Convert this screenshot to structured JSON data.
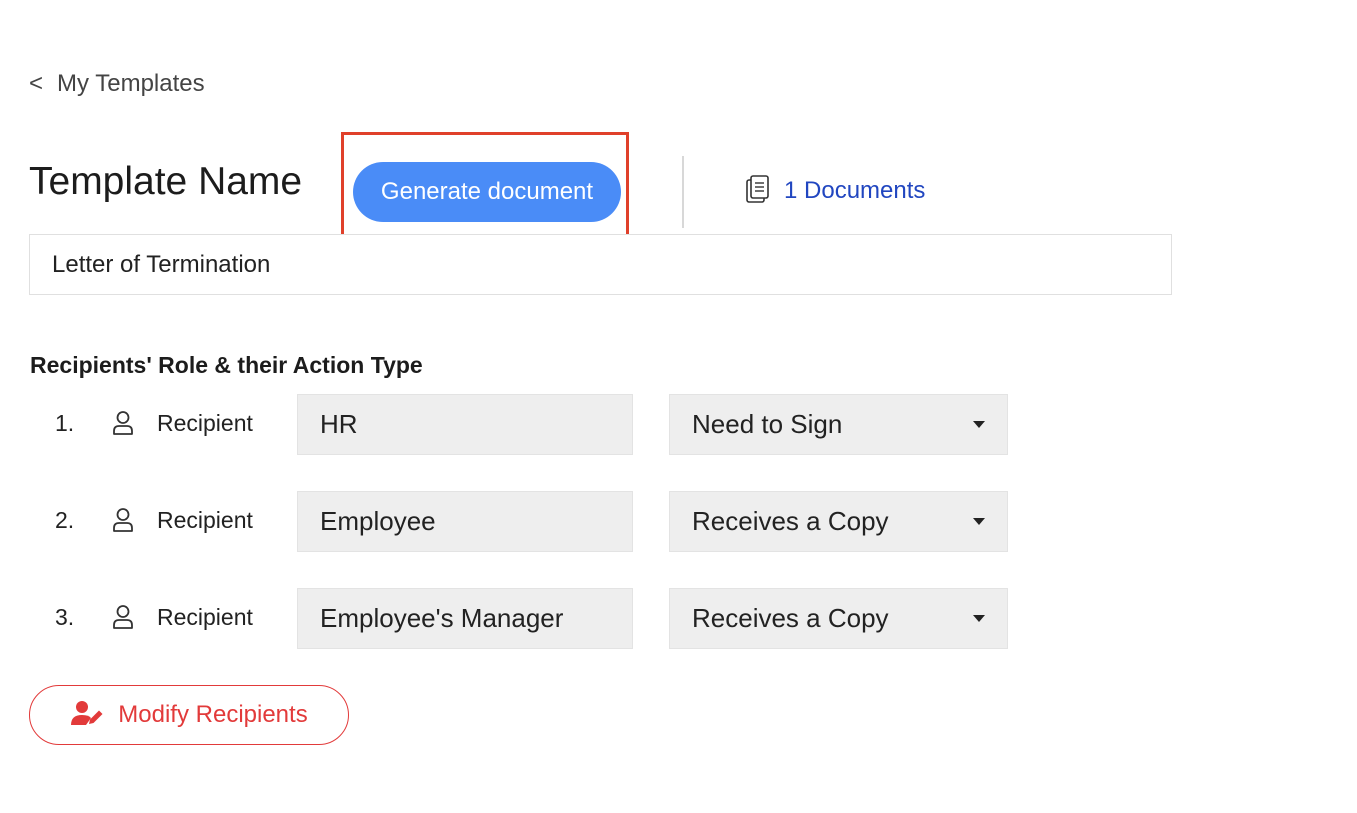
{
  "nav": {
    "back_chevron": "<",
    "back_label": "My Templates"
  },
  "header": {
    "title": "Template Name",
    "generate_button": "Generate document",
    "documents_link": "1 Documents",
    "documents_icon": "document-stack-icon",
    "highlight_color": "#e0402a"
  },
  "template_name": {
    "value": "Letter of Termination"
  },
  "recipients": {
    "heading": "Recipients' Role & their Action Type",
    "rows": [
      {
        "number": "1.",
        "label": "Recipient",
        "role": "HR",
        "action": "Need to Sign"
      },
      {
        "number": "2.",
        "label": "Recipient",
        "role": "Employee",
        "action": "Receives a Copy"
      },
      {
        "number": "3.",
        "label": "Recipient",
        "role": "Employee's Manager",
        "action": "Receives a Copy"
      }
    ],
    "modify_button": "Modify Recipients"
  },
  "colors": {
    "primary_button": "#4a8cf7",
    "link": "#2146c0",
    "danger": "#e23a3a",
    "field_bg": "#eeeeee"
  }
}
